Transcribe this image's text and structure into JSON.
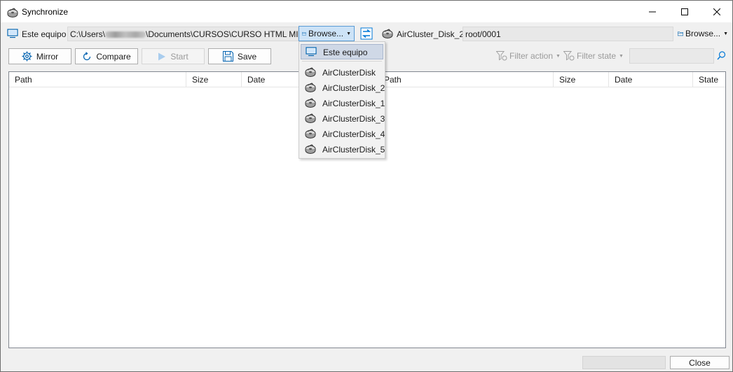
{
  "window": {
    "title": "Synchronize",
    "controls": {
      "minimize": "minimize-icon",
      "maximize": "maximize-icon",
      "close": "close-icon"
    }
  },
  "left_location": {
    "label": "Este equipo",
    "path_prefix": "C:\\Users\\",
    "path_suffix": "\\Documents\\CURSOS\\CURSO HTML MIRIA",
    "browse_label": "Browse..."
  },
  "right_location": {
    "label": "AirCluster_Disk_2",
    "path": "root/0001",
    "browse_label": "Browse..."
  },
  "toolbar": {
    "mirror_label": "Mirror",
    "compare_label": "Compare",
    "start_label": "Start",
    "save_label": "Save",
    "filter_action_label": "Filter action",
    "filter_state_label": "Filter state"
  },
  "columns": [
    "Path",
    "Size",
    "Date",
    "Path",
    "Size",
    "Date",
    "State"
  ],
  "browse_menu": {
    "items": [
      {
        "label": "Este equipo",
        "icon": "computer-icon",
        "selected": true
      },
      {
        "label": "AirClusterDisk",
        "icon": "disk-icon",
        "selected": false
      },
      {
        "label": "AirClusterDisk_2",
        "icon": "disk-icon",
        "selected": false
      },
      {
        "label": "AirClusterDisk_1",
        "icon": "disk-icon",
        "selected": false
      },
      {
        "label": "AirClusterDisk_3",
        "icon": "disk-icon",
        "selected": false
      },
      {
        "label": "AirClusterDisk_4",
        "icon": "disk-icon",
        "selected": false
      },
      {
        "label": "AirClusterDisk_5",
        "icon": "disk-icon",
        "selected": false
      }
    ]
  },
  "footer": {
    "close_label": "Close"
  },
  "colors": {
    "accent": "#0078d7",
    "selected_bg": "#cde3f7",
    "menu_selected_bg": "#cfd8e6"
  }
}
